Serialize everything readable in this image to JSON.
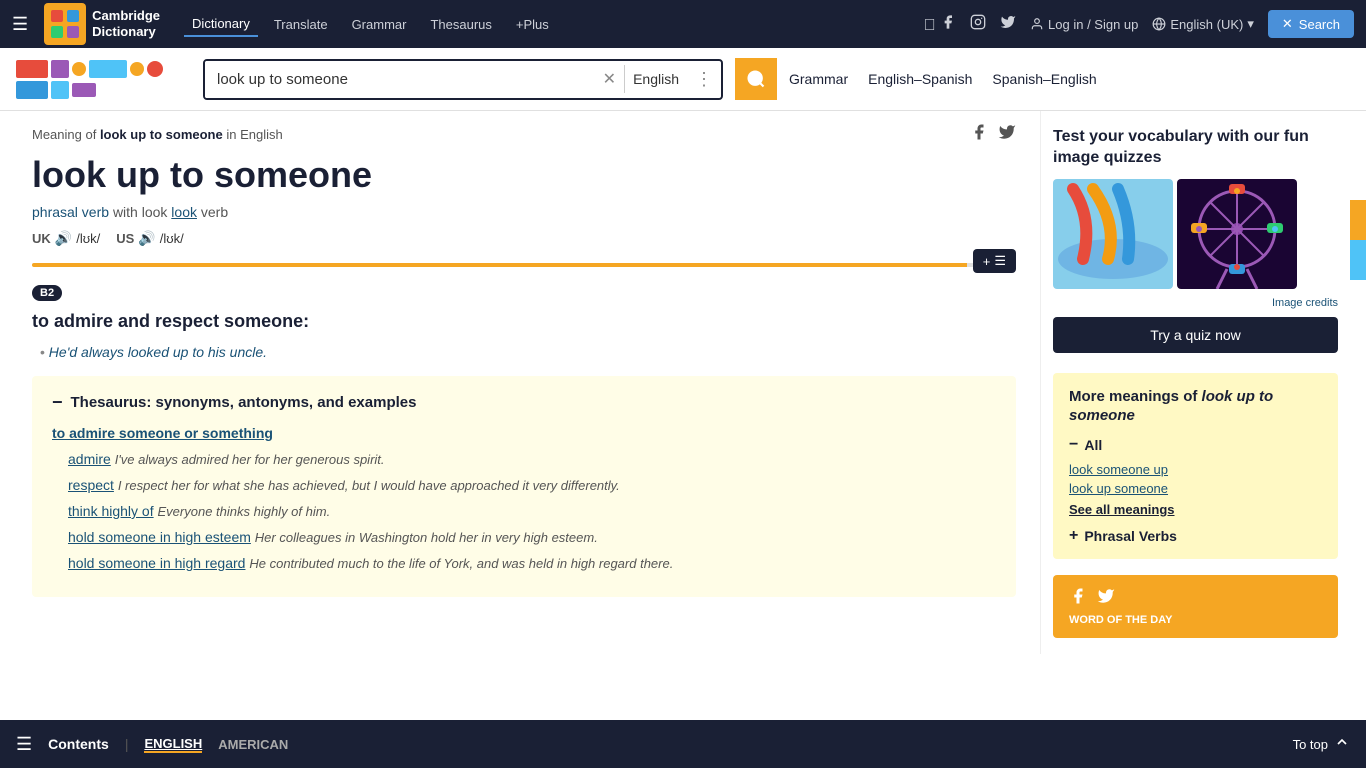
{
  "topNav": {
    "logoLine1": "Cambridge",
    "logoLine2": "Dictionary",
    "links": [
      {
        "label": "Dictionary",
        "active": true
      },
      {
        "label": "Translate",
        "active": false
      },
      {
        "label": "Grammar",
        "active": false
      },
      {
        "label": "Thesaurus",
        "active": false
      },
      {
        "label": "+Plus",
        "active": false
      }
    ],
    "loginLabel": "Log in / Sign up",
    "langLabel": "English (UK)",
    "searchLabel": "Search"
  },
  "searchBar": {
    "query": "look up to someone",
    "lang": "English",
    "navLinks": [
      "Grammar",
      "English–Spanish",
      "Spanish–English"
    ]
  },
  "breadcrumb": {
    "prefix": "Meaning of ",
    "term": "look up to someone",
    "suffix": " in English"
  },
  "entry": {
    "title": "look up to someone",
    "posLabel": "phrasal verb",
    "withLabel": "with look",
    "verbLabel": "verb",
    "ukLabel": "UK",
    "ukIpa": "/lʊk/",
    "usLabel": "US",
    "usIpa": "/lʊk/",
    "levelBadge": "B2",
    "definition": "to admire and respect someone:",
    "example": "He'd always looked up to his uncle.",
    "thesaurus": {
      "headerLabel": "Thesaurus: synonyms, antonyms, and examples",
      "subLinkLabel": "to admire someone or something",
      "entries": [
        {
          "term": "admire",
          "eg": "I've always admired her for her generous spirit."
        },
        {
          "term": "respect",
          "eg": "I respect her for what she has achieved, but I would have approached it very differently."
        },
        {
          "term": "think highly of",
          "eg": "Everyone thinks highly of him."
        },
        {
          "term": "hold someone in high esteem",
          "eg": "Her colleagues in Washington hold her in very high esteem."
        },
        {
          "term": "hold someone in high regard",
          "eg": "He contributed much to the life of York, and was held in high regard there."
        }
      ]
    }
  },
  "sidebar": {
    "quizTitle": "Test your vocabulary with our fun image quizzes",
    "imageCredits": "Image credits",
    "tryQuizLabel": "Try a quiz now",
    "moreMeaningsTitle": "More meanings of look up to someone",
    "allLabel": "All",
    "meanings": [
      {
        "label": "look someone up"
      },
      {
        "label": "look up someone"
      }
    ],
    "seeAllLabel": "See all meanings",
    "phrasalVerbsLabel": "Phrasal Verbs",
    "wordOfDayLabel": "WORD OF THE DAY"
  },
  "bottomBar": {
    "contentsLabel": "Contents",
    "englishLabel": "ENGLISH",
    "americanLabel": "AMERICAN",
    "toTopLabel": "To top"
  },
  "goldLineBtn": "+≡"
}
